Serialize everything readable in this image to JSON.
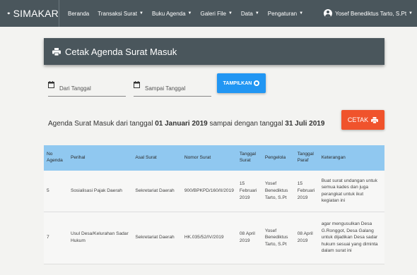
{
  "navbar": {
    "brand": "SIMAKAR",
    "menu": [
      {
        "label": "Beranda",
        "dropdown": false
      },
      {
        "label": "Transaksi Surat",
        "dropdown": true
      },
      {
        "label": "Buku Agenda",
        "dropdown": true
      },
      {
        "label": "Galeri File",
        "dropdown": true
      },
      {
        "label": "Data",
        "dropdown": true
      },
      {
        "label": "Pengaturan",
        "dropdown": true
      }
    ],
    "user": "Yosef Benediktus Tarto, S.Pt"
  },
  "page": {
    "title": "Cetak Agenda Surat Masuk"
  },
  "filter": {
    "from_placeholder": "Dari Tanggal",
    "to_placeholder": "Sampai Tanggal",
    "submit_label": "TAMPILKAN"
  },
  "agenda": {
    "prefix": "Agenda Surat Masuk dari tanggal",
    "start": "01 Januari 2019",
    "middle": "sampai dengan tanggal",
    "end": "31 Juli 2019"
  },
  "print_button": "CETAK",
  "table": {
    "headers": [
      "No Agenda",
      "Perihal",
      "Asal Surat",
      "Nomor Surat",
      "Tanggal Surat",
      "Pengelola",
      "Tanggal Paraf",
      "Keterangan"
    ],
    "rows": [
      [
        "5",
        "Sosialisasi Pajak Daerah",
        "Sekretariat Daerah",
        "900/BPKPD/160/II/2019",
        "15 Februari 2019",
        "Yosef Benediktus Tarto, S.Pt",
        "15 Februari 2019",
        "Buat surat undangan untuk semua kades dan juga perangkat untuk ikut kegiatan ini"
      ],
      [
        "7",
        "Usul Desa/Kelurahan Sadar Hukum",
        "Sekretariat Daerah",
        "HK.035/52/IV/2019",
        "08 April 2019",
        "Yosef Benediktus Tarto, S.Pt",
        "08 April 2019",
        "agar mengusulkan Desa G.Ronggot, Desa Galang untuk dijadikan Desa sadar hukum sesuai yang diminta dalam surat ini"
      ]
    ]
  },
  "colors": {
    "navbar": "#4a565c",
    "primary": "#2196f3",
    "print": "#f0532c",
    "table_header": "#90c8f0"
  },
  "icons": {
    "brand": "graduation-cap-icon",
    "user": "user-circle-icon",
    "print": "printer-icon",
    "calendar": "calendar-icon"
  }
}
